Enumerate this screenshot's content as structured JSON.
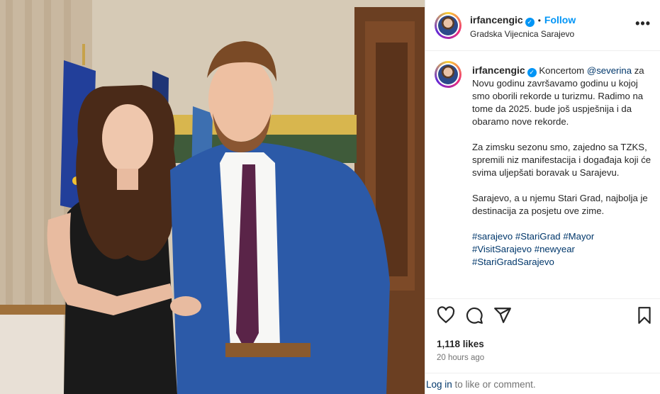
{
  "post": {
    "username": "irfancengic",
    "verified_mark": "✓",
    "separator": "•",
    "follow_label": "Follow",
    "location": "Gradska Vijecnica Sarajevo",
    "more_icon": "more-horizontal-icon",
    "more_glyph": "•••"
  },
  "caption": {
    "username": "irfancengic",
    "mention": "@severina",
    "line1_prefix": " Koncertom ",
    "line1_rest": " za Novu godinu završavamo godinu u kojoj smo oborili rekorde u turizmu. Radimo na tome da 2025. bude još uspješnija i da obaramo nove rekorde.",
    "paragraph2": "Za zimsku sezonu smo, zajedno sa TZKS, spremili niz manifestacija i događaja koji će svima uljepšati boravak u Sarajevu.",
    "paragraph3": "Sarajevo, a u njemu Stari Grad, najbolja je destinacija za posjetu ove zime.",
    "hashtags": [
      "#sarajevo",
      "#StariGrad",
      "#Mayor",
      "#VisitSarajevo",
      "#newyear",
      "#StariGradSarajevo"
    ]
  },
  "actions": {
    "like_icon": "heart-icon",
    "comment_icon": "comment-icon",
    "share_icon": "share-icon",
    "save_icon": "bookmark-icon"
  },
  "likes_text": "1,118 likes",
  "time_text": "20 hours ago",
  "footer": {
    "login_link": "Log in",
    "login_rest": " to like or comment."
  },
  "colors": {
    "accent": "#0095f6",
    "link": "#00376b",
    "text": "#262626",
    "muted": "#737373"
  }
}
